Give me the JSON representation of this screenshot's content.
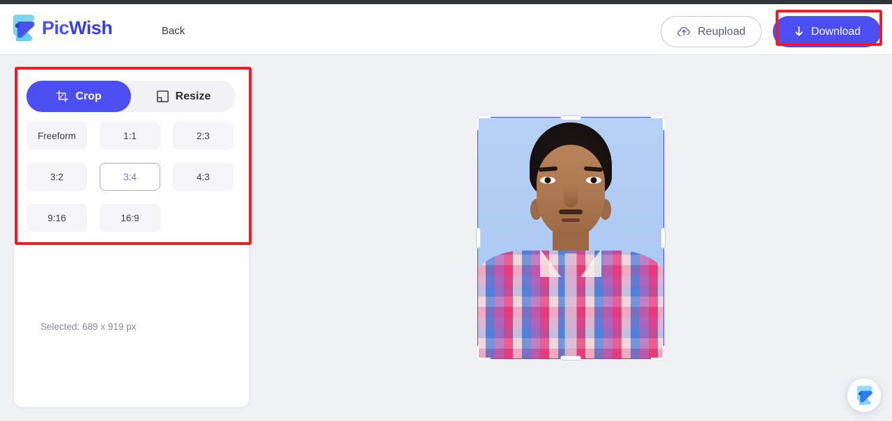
{
  "header": {
    "brand_pic": "Pic",
    "brand_wish": "Wish",
    "logo_icon": "picwish-logo-icon",
    "back_label": "Back",
    "reupload_label": "Reupload",
    "reupload_icon": "cloud-upload-icon",
    "download_label": "Download",
    "download_icon": "download-arrow-icon",
    "accent_color": "#4b4ef0",
    "annotation_color": "#ee1c25"
  },
  "panel": {
    "tabs": [
      {
        "label": "Crop",
        "icon": "crop-icon",
        "active": true
      },
      {
        "label": "Resize",
        "icon": "resize-icon",
        "active": false
      }
    ],
    "ratios": [
      {
        "label": "Freeform",
        "selected": false
      },
      {
        "label": "1:1",
        "selected": false
      },
      {
        "label": "2:3",
        "selected": false
      },
      {
        "label": "3:2",
        "selected": false
      },
      {
        "label": "3:4",
        "selected": true
      },
      {
        "label": "4:3",
        "selected": false
      },
      {
        "label": "9:16",
        "selected": false
      },
      {
        "label": "16:9",
        "selected": false
      }
    ],
    "selected_info": "Selected: 689 x 919 px"
  },
  "canvas": {
    "image_alt": "portrait-photo-blue-background",
    "crop_frame_color": "#4b4ef0",
    "handles": [
      "top-left",
      "top-right",
      "bottom-left",
      "bottom-right",
      "top",
      "bottom",
      "left",
      "right"
    ]
  },
  "fab": {
    "icon": "picwish-logo-icon"
  }
}
